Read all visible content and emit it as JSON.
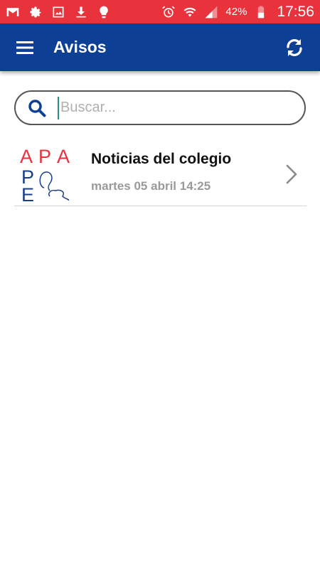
{
  "status_bar": {
    "left_icons": [
      "gmail-icon",
      "settings-icon",
      "image-icon",
      "download-icon",
      "lightbulb-icon"
    ],
    "right_icons": [
      "alarm-icon",
      "wifi-icon",
      "signal-icon",
      "battery-icon"
    ],
    "battery_percent": "42%",
    "time": "17:56",
    "color": "#e8323c"
  },
  "app_bar": {
    "title": "Avisos",
    "menu_icon": "menu-icon",
    "refresh_icon": "refresh-icon",
    "color": "#0d3f94"
  },
  "search": {
    "placeholder": "Buscar...",
    "value": ""
  },
  "list": {
    "items": [
      {
        "logo": {
          "top_row": [
            "A",
            "P",
            "A"
          ],
          "left_column": [
            "P",
            "E"
          ]
        },
        "title": "Noticias del colegio",
        "date": "martes 05 abril 14:25"
      }
    ]
  }
}
